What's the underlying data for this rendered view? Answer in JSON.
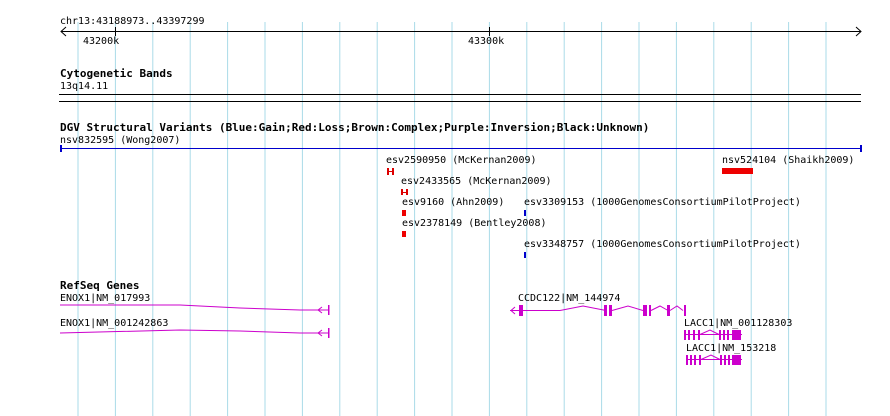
{
  "ruler": {
    "range_label": "chr13:43188973..43397299",
    "ticks": [
      "43200k",
      "43300k"
    ]
  },
  "cytoband": {
    "title": "Cytogenetic Bands",
    "band_label": "13q14.11"
  },
  "dgv": {
    "title": "DGV Structural Variants (Blue:Gain;Red:Loss;Brown:Complex;Purple:Inversion;Black:Unknown)",
    "variants": [
      {
        "label": "nsv832595 (Wong2007)",
        "color": "#0000cc"
      },
      {
        "label": "esv2590950 (McKernan2009)",
        "color": "#dd0000"
      },
      {
        "label": "nsv524104 (Shaikh2009)",
        "color": "#ee0000"
      },
      {
        "label": "esv2433565 (McKernan2009)",
        "color": "#dd0000"
      },
      {
        "label": "esv9160 (Ahn2009)",
        "color": "#ee0000"
      },
      {
        "label": "esv3309153 (1000GenomesConsortiumPilotProject)",
        "color": "#0000cc"
      },
      {
        "label": "esv2378149 (Bentley2008)",
        "color": "#ee0000"
      },
      {
        "label": "esv3348757 (1000GenomesConsortiumPilotProject)",
        "color": "#0000cc"
      }
    ]
  },
  "refseq": {
    "title": "RefSeq Genes",
    "color": "#cc00cc",
    "genes": [
      {
        "label": "ENOX1|NM_017993"
      },
      {
        "label": "ENOX1|NM_001242863"
      },
      {
        "label": "CCDC122|NM_144974"
      },
      {
        "label": "LACC1|NM_001128303"
      },
      {
        "label": "LACC1|NM_153218"
      }
    ]
  },
  "colors": {
    "grid": "#aadbe8",
    "ruler": "#000000",
    "gain": "#0000cc",
    "loss": "#ee0000",
    "gene": "#cc00cc"
  }
}
